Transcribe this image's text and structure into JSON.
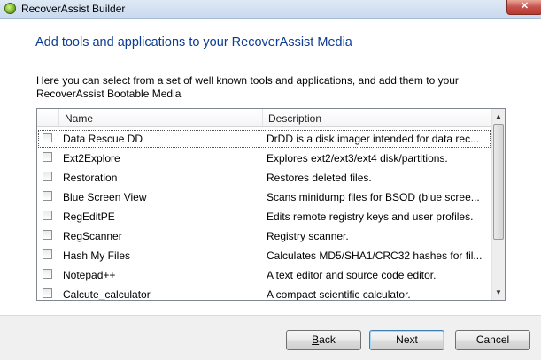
{
  "window": {
    "title": "RecoverAssist Builder",
    "close_label": "✕"
  },
  "page": {
    "heading": "Add tools and applications to your RecoverAssist Media",
    "description": "Here you can select from a set of well known tools and applications, and add them to your RecoverAssist Bootable Media"
  },
  "list": {
    "columns": {
      "name": "Name",
      "description": "Description"
    },
    "rows": [
      {
        "name": "Data Rescue DD",
        "description": "DrDD is a disk imager intended for data rec...",
        "checked": false
      },
      {
        "name": "Ext2Explore",
        "description": "Explores ext2/ext3/ext4 disk/partitions.",
        "checked": false
      },
      {
        "name": "Restoration",
        "description": "Restores deleted files.",
        "checked": false
      },
      {
        "name": "Blue Screen View",
        "description": "Scans minidump files for BSOD (blue scree...",
        "checked": false
      },
      {
        "name": "RegEditPE",
        "description": "Edits remote registry keys and user profiles.",
        "checked": false
      },
      {
        "name": "RegScanner",
        "description": "Registry scanner.",
        "checked": false
      },
      {
        "name": "Hash My Files",
        "description": "Calculates MD5/SHA1/CRC32 hashes for fil...",
        "checked": false
      },
      {
        "name": "Notepad++",
        "description": "A text editor and source code editor.",
        "checked": false
      },
      {
        "name": "Calcute_calculator",
        "description": "A compact scientific calculator.",
        "checked": false
      }
    ]
  },
  "buttons": {
    "back_mnemonic": "B",
    "back_rest": "ack",
    "next": "Next",
    "cancel": "Cancel"
  },
  "colors": {
    "heading": "#0b3c94",
    "footer": "#f0f0f0"
  }
}
